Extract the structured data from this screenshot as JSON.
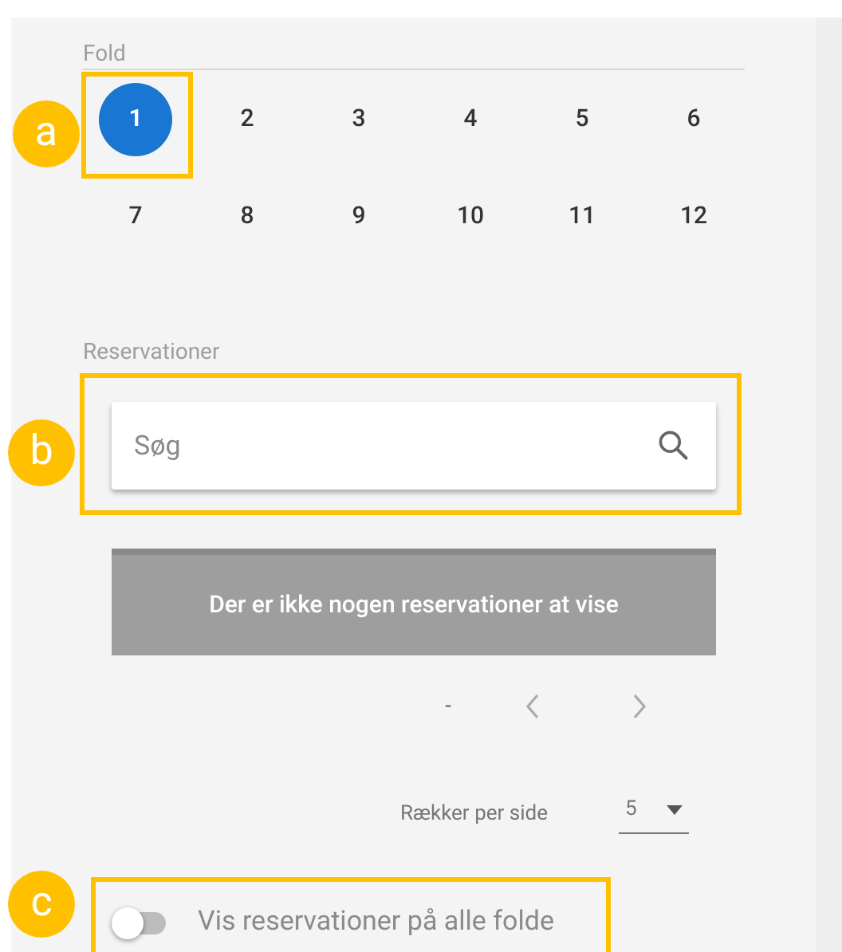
{
  "fold": {
    "label": "Fold",
    "items": [
      {
        "label": "1",
        "selected": true
      },
      {
        "label": "2",
        "selected": false
      },
      {
        "label": "3",
        "selected": false
      },
      {
        "label": "4",
        "selected": false
      },
      {
        "label": "5",
        "selected": false
      },
      {
        "label": "6",
        "selected": false
      },
      {
        "label": "7",
        "selected": false
      },
      {
        "label": "8",
        "selected": false
      },
      {
        "label": "9",
        "selected": false
      },
      {
        "label": "10",
        "selected": false
      },
      {
        "label": "11",
        "selected": false
      },
      {
        "label": "12",
        "selected": false
      }
    ]
  },
  "reservations": {
    "label": "Reservationer",
    "search": {
      "placeholder": "Søg"
    },
    "empty_message": "Der er ikke nogen reservationer at vise",
    "pagination": {
      "range": "-"
    },
    "rows_per_page": {
      "label": "Rækker per side",
      "value": "5"
    }
  },
  "toggle": {
    "label": "Vis reservationer på alle folde",
    "on": false
  },
  "callouts": [
    {
      "letter": "a"
    },
    {
      "letter": "b"
    },
    {
      "letter": "c"
    }
  ]
}
